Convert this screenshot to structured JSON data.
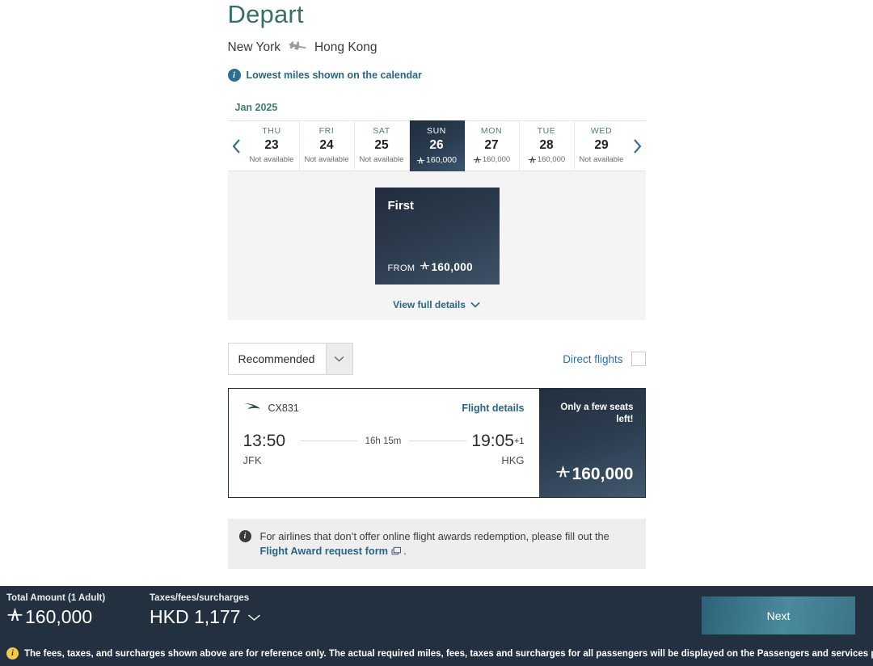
{
  "header": {
    "title": "Depart",
    "origin": "New York",
    "destination": "Hong Kong",
    "plane_icon": "airplane-icon",
    "lowest_miles_note": "Lowest miles shown on the calendar",
    "info_icon": "info-icon"
  },
  "calendar": {
    "month": "Jan 2025",
    "prev_icon": "chevron-left-icon",
    "next_icon": "chevron-right-icon",
    "days": [
      {
        "dow": "THU",
        "date": "23",
        "status": "Not available",
        "miles": "",
        "selected": false
      },
      {
        "dow": "FRI",
        "date": "24",
        "status": "Not available",
        "miles": "",
        "selected": false
      },
      {
        "dow": "SAT",
        "date": "25",
        "status": "Not available",
        "miles": "",
        "selected": false
      },
      {
        "dow": "SUN",
        "date": "26",
        "status": "",
        "miles": "160,000",
        "selected": true
      },
      {
        "dow": "MON",
        "date": "27",
        "status": "",
        "miles": "160,000",
        "selected": false
      },
      {
        "dow": "TUE",
        "date": "28",
        "status": "",
        "miles": "160,000",
        "selected": false
      },
      {
        "dow": "WED",
        "date": "29",
        "status": "Not available",
        "miles": "",
        "selected": false
      }
    ]
  },
  "fare": {
    "cabin": "First",
    "from_label": "FROM",
    "from_miles": "160,000",
    "view_details": "View full details",
    "chevron_icon": "chevron-down-icon"
  },
  "filters": {
    "sort_value": "Recommended",
    "sort_caret_icon": "chevron-down-icon",
    "direct_label": "Direct flights",
    "direct_checked": false
  },
  "flight": {
    "airline_logo": "cathay-brushwing-icon",
    "flight_number": "CX831",
    "details_link": "Flight details",
    "depart_time": "13:50",
    "depart_code": "JFK",
    "duration": "16h 15m",
    "arrive_time": "19:05",
    "arrive_day_offset": "+1",
    "arrive_code": "HKG",
    "seats_notice": "Only a few seats left!",
    "price_miles": "160,000"
  },
  "notice": {
    "icon": "info-icon",
    "text_before": "For airlines that don’t offer online flight awards redemption, please fill out the",
    "link_text": "Flight Award request form",
    "external_icon": "external-window-icon",
    "text_after": "."
  },
  "footer": {
    "total_label": "Total Amount (1 Adult)",
    "total_miles": "160,000",
    "taxes_label": "Taxes/fees/surcharges",
    "taxes_value": "HKD 1,177",
    "taxes_caret_icon": "chevron-down-icon",
    "next_label": "Next",
    "warning_icon": "warning-icon",
    "disclaimer": "The fees, taxes, and surcharges shown above are for reference only. The actual required miles, fees, taxes and surcharges for all passengers will be displayed on the Passengers and services page."
  },
  "colors": {
    "title_green": "#367067",
    "link_blue": "#2b6580",
    "dark_navy": "#22303f",
    "accent_teal": "#4a8a9d",
    "warning_yellow": "#f2cb4c"
  }
}
